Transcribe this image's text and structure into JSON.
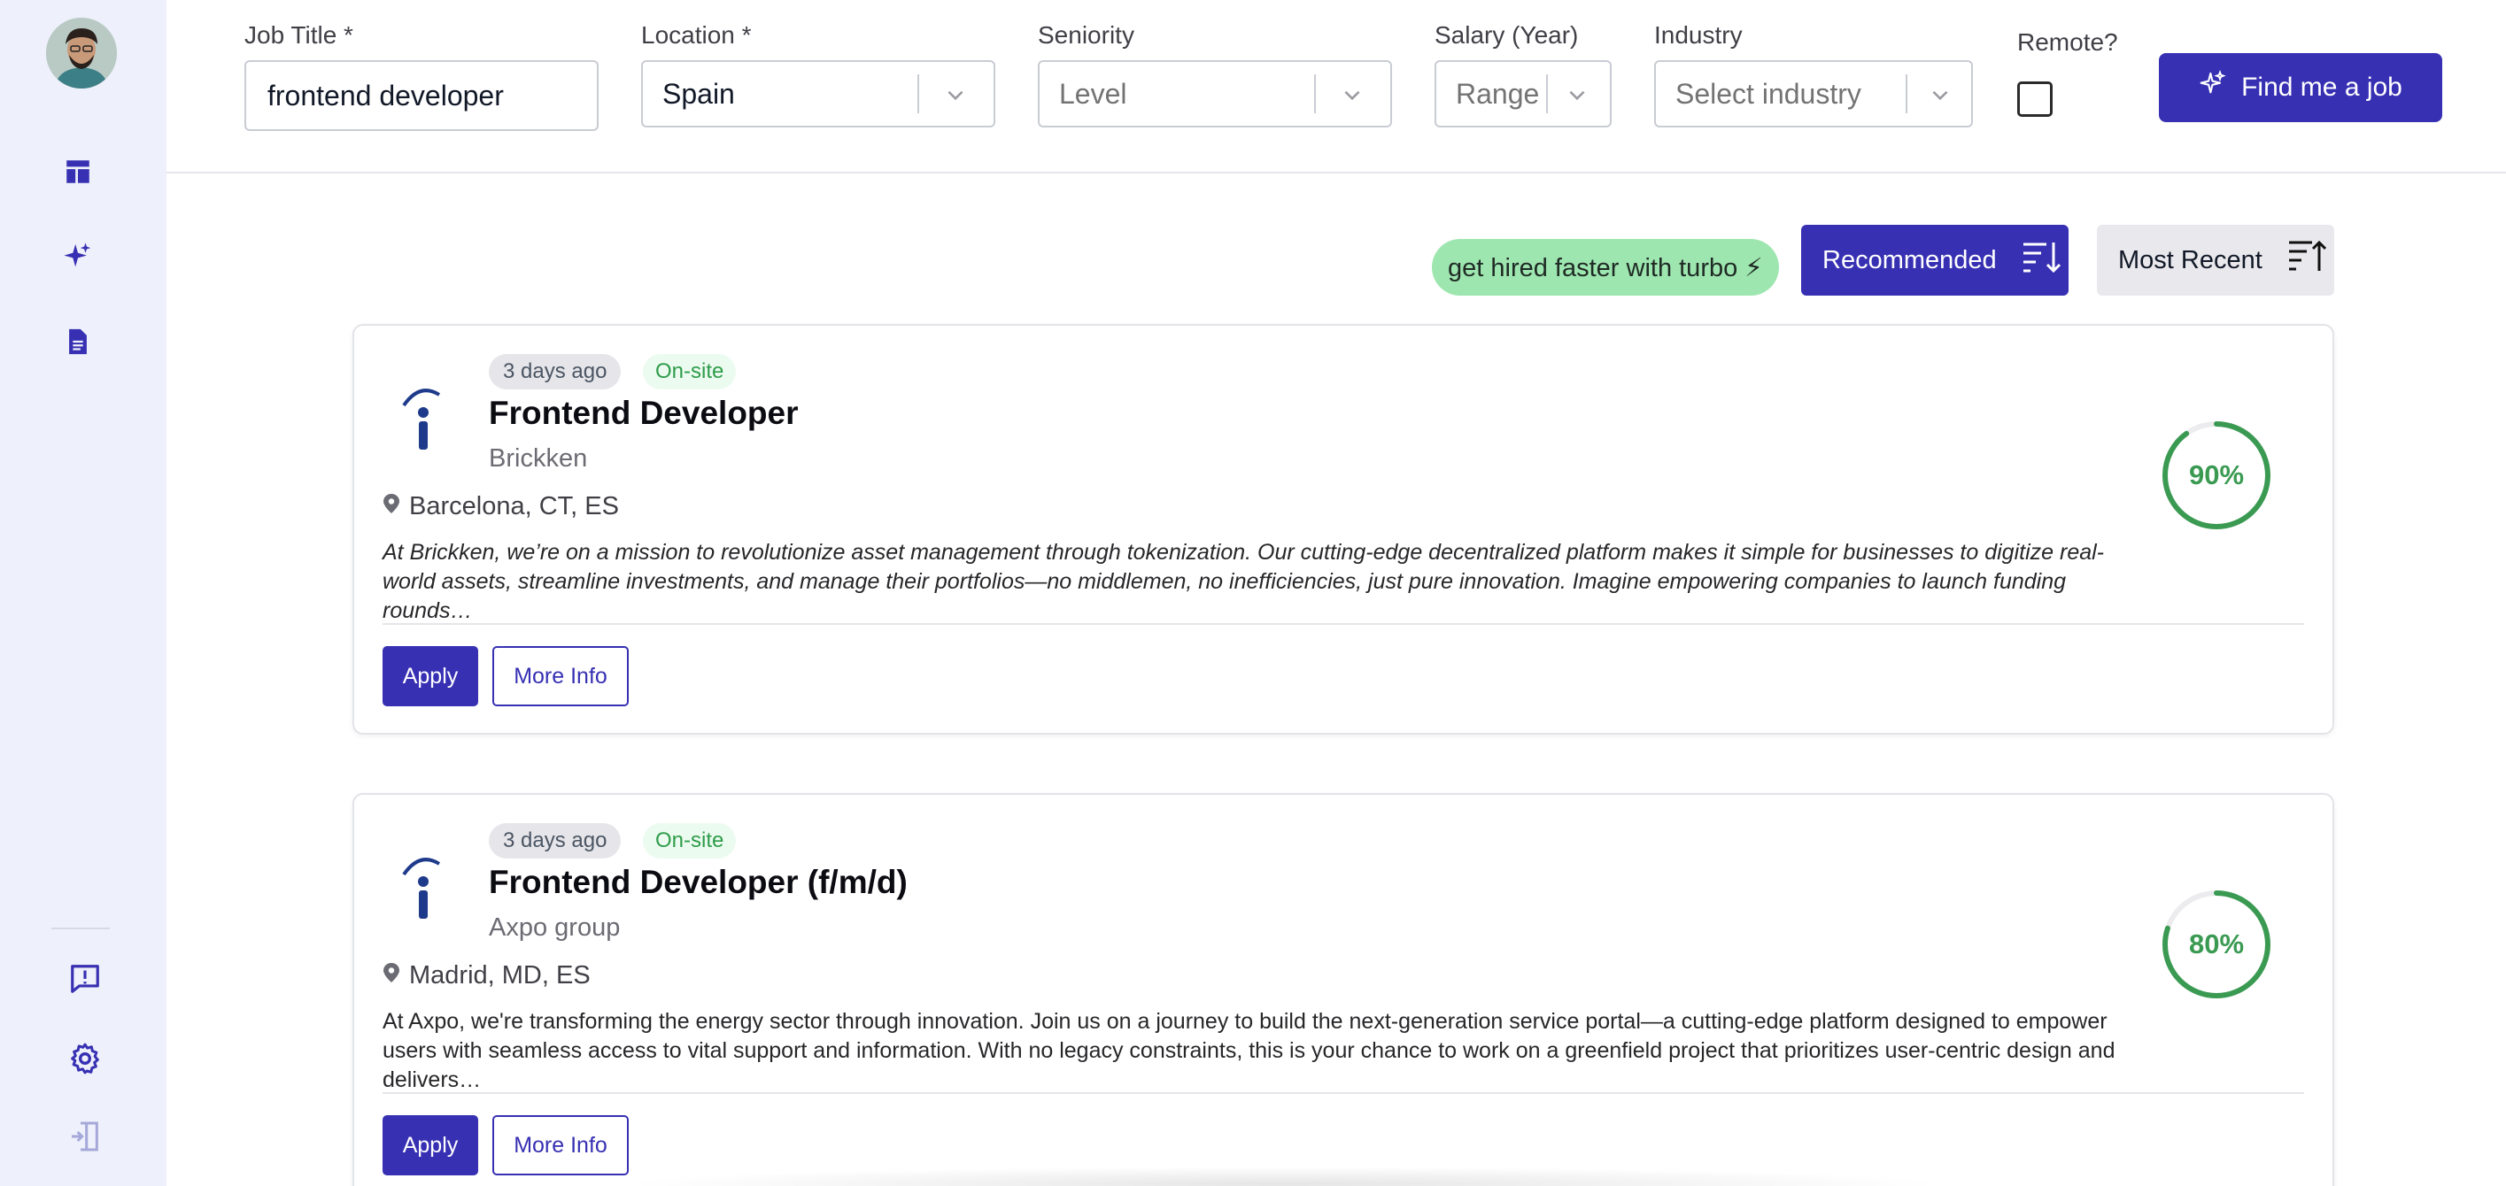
{
  "sidebar": {
    "avatar_alt": "user avatar",
    "top_icons": [
      "dashboard-icon",
      "sparkles-icon",
      "document-icon"
    ],
    "bottom_icons": [
      "feedback-icon",
      "gear-icon",
      "logout-icon"
    ],
    "accent_color": "#3730b3"
  },
  "filters": {
    "job_title": {
      "label": "Job Title *",
      "value": "frontend developer"
    },
    "location": {
      "label": "Location *",
      "value": "Spain"
    },
    "seniority": {
      "label": "Seniority",
      "placeholder": "Level"
    },
    "salary": {
      "label": "Salary (Year)",
      "placeholder": "Range"
    },
    "industry": {
      "label": "Industry",
      "placeholder": "Select industry"
    },
    "remote": {
      "label": "Remote?",
      "checked": false
    },
    "find_button": "Find me a job"
  },
  "sort_bar": {
    "turbo": "get hired faster with turbo ⚡",
    "recommended": "Recommended",
    "most_recent": "Most Recent",
    "active": "Recommended"
  },
  "jobs": [
    {
      "posted": "3 days ago",
      "work_type": "On-site",
      "title": "Frontend Developer",
      "company": "Brickken",
      "location": "Barcelona, CT, ES",
      "description": "At Brickken, we’re on a mission to revolutionize asset management through tokenization. Our cutting-edge decentralized platform makes it simple for businesses to digitize real-world assets, streamline investments, and manage their portfolios—no middlemen, no inefficiencies, just pure innovation. Imagine empowering companies to launch funding rounds…",
      "match": 0.9,
      "match_label": "90%",
      "apply_label": "Apply",
      "info_label": "More Info"
    },
    {
      "posted": "3 days ago",
      "work_type": "On-site",
      "title": "Frontend Developer (f/m/d)",
      "company": "Axpo group",
      "location": "Madrid, MD, ES",
      "description": "At Axpo, we're transforming the energy sector through innovation. Join us on a journey to build the next-generation service portal—a cutting-edge platform designed to empower users with seamless access to vital support and information. With no legacy constraints, this is your chance to work on a greenfield project that prioritizes user-centric design and delivers…",
      "match": 0.8,
      "match_label": "80%",
      "apply_label": "Apply",
      "info_label": "More Info"
    }
  ],
  "colors": {
    "primary": "#3730b3",
    "match_green": "#3a9a52",
    "onsite_green": "#2e9c4a",
    "turbo_green": "#9ee6b0"
  }
}
